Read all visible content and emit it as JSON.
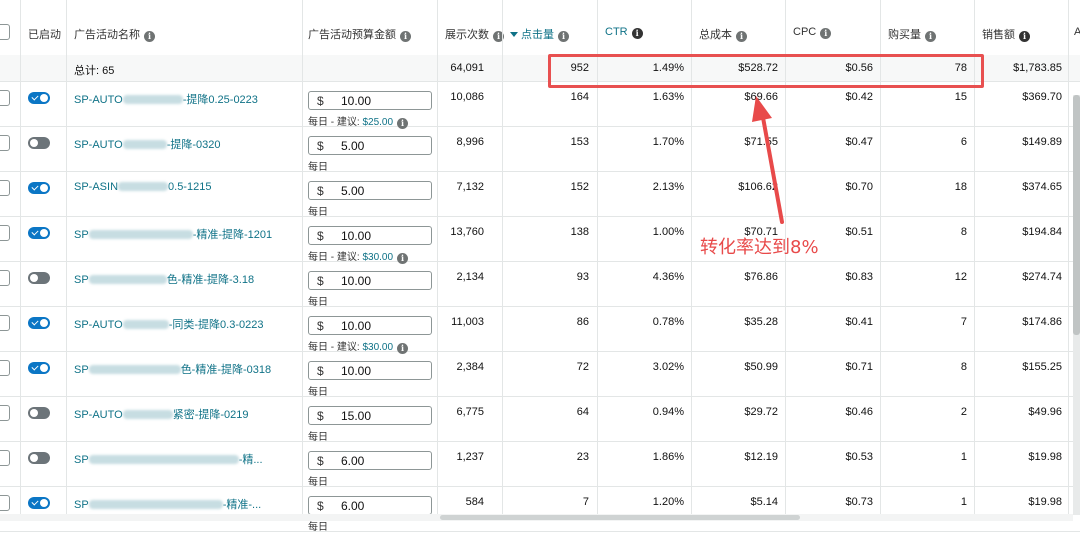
{
  "header": {
    "enabled": "已启动",
    "campaign_name": "广告活动名称",
    "budget": "广告活动预算金额",
    "impressions": "展示次数",
    "clicks": "点击量",
    "ctr": "CTR",
    "spend": "总成本",
    "cpc": "CPC",
    "orders": "购买量",
    "sales": "销售额",
    "next_col": "A"
  },
  "total": {
    "label": "总计: 65",
    "impressions": "64,091",
    "clicks": "952",
    "ctr": "1.49%",
    "spend": "$528.72",
    "cpc": "$0.56",
    "orders": "78",
    "sales": "$1,783.85"
  },
  "currency": "$",
  "budget_daily": "每日",
  "budget_suggest": "每日 - 建议:",
  "rows": [
    {
      "on": true,
      "pre": "SP-AUTO",
      "blur": 60,
      "post": "-提降0.25-0223",
      "budget": "10.00",
      "sugg": "$25.00",
      "imp": "10,086",
      "clk": "164",
      "ctr": "1.63%",
      "spend": "$69.66",
      "cpc": "$0.42",
      "ord": "15",
      "sales": "$369.70"
    },
    {
      "on": false,
      "pre": "SP-AUTO",
      "blur": 44,
      "post": "-提降-0320",
      "budget": "5.00",
      "sugg": "",
      "imp": "8,996",
      "clk": "153",
      "ctr": "1.70%",
      "spend": "$71.55",
      "cpc": "$0.47",
      "ord": "6",
      "sales": "$149.89"
    },
    {
      "on": true,
      "pre": "SP-ASIN",
      "blur": 50,
      "post": "0.5-1215",
      "budget": "5.00",
      "sugg": "",
      "imp": "7,132",
      "clk": "152",
      "ctr": "2.13%",
      "spend": "$106.62",
      "cpc": "$0.70",
      "ord": "18",
      "sales": "$374.65"
    },
    {
      "on": true,
      "pre": "SP",
      "blur": 104,
      "post": "-精准-提降-1201",
      "budget": "10.00",
      "sugg": "$30.00",
      "imp": "13,760",
      "clk": "138",
      "ctr": "1.00%",
      "spend": "$70.71",
      "cpc": "$0.51",
      "ord": "8",
      "sales": "$194.84"
    },
    {
      "on": false,
      "pre": "SP",
      "blur": 78,
      "post": "色-精准-提降-3.18",
      "budget": "10.00",
      "sugg": "",
      "imp": "2,134",
      "clk": "93",
      "ctr": "4.36%",
      "spend": "$76.86",
      "cpc": "$0.83",
      "ord": "12",
      "sales": "$274.74"
    },
    {
      "on": true,
      "pre": "SP-AUTO",
      "blur": 46,
      "post": "-同类-提降0.3-0223",
      "budget": "10.00",
      "sugg": "$30.00",
      "imp": "11,003",
      "clk": "86",
      "ctr": "0.78%",
      "spend": "$35.28",
      "cpc": "$0.41",
      "ord": "7",
      "sales": "$174.86"
    },
    {
      "on": true,
      "pre": "SP",
      "blur": 92,
      "post": "色-精准-提降-0318",
      "budget": "10.00",
      "sugg": "",
      "imp": "2,384",
      "clk": "72",
      "ctr": "3.02%",
      "spend": "$50.99",
      "cpc": "$0.71",
      "ord": "8",
      "sales": "$155.25"
    },
    {
      "on": false,
      "pre": "SP-AUTO",
      "blur": 50,
      "post": "紧密-提降-0219",
      "budget": "15.00",
      "sugg": "",
      "imp": "6,775",
      "clk": "64",
      "ctr": "0.94%",
      "spend": "$29.72",
      "cpc": "$0.46",
      "ord": "2",
      "sales": "$49.96"
    },
    {
      "on": false,
      "pre": "SP",
      "blur": 150,
      "post": "-精...",
      "budget": "6.00",
      "sugg": "",
      "imp": "1,237",
      "clk": "23",
      "ctr": "1.86%",
      "spend": "$12.19",
      "cpc": "$0.53",
      "ord": "1",
      "sales": "$19.98"
    },
    {
      "on": true,
      "pre": "SP",
      "blur": 134,
      "post": "-精准-...",
      "budget": "6.00",
      "sugg": "",
      "imp": "584",
      "clk": "7",
      "ctr": "1.20%",
      "spend": "$5.14",
      "cpc": "$0.73",
      "ord": "1",
      "sales": "$19.98"
    }
  ],
  "annotation": {
    "text": "转化率达到8%",
    "color": "#e84a4a"
  },
  "colors": {
    "link": "#0f7287",
    "toggle_on": "#0b76c5",
    "toggle_off": "#6c7479",
    "highlight": "#e85050"
  }
}
